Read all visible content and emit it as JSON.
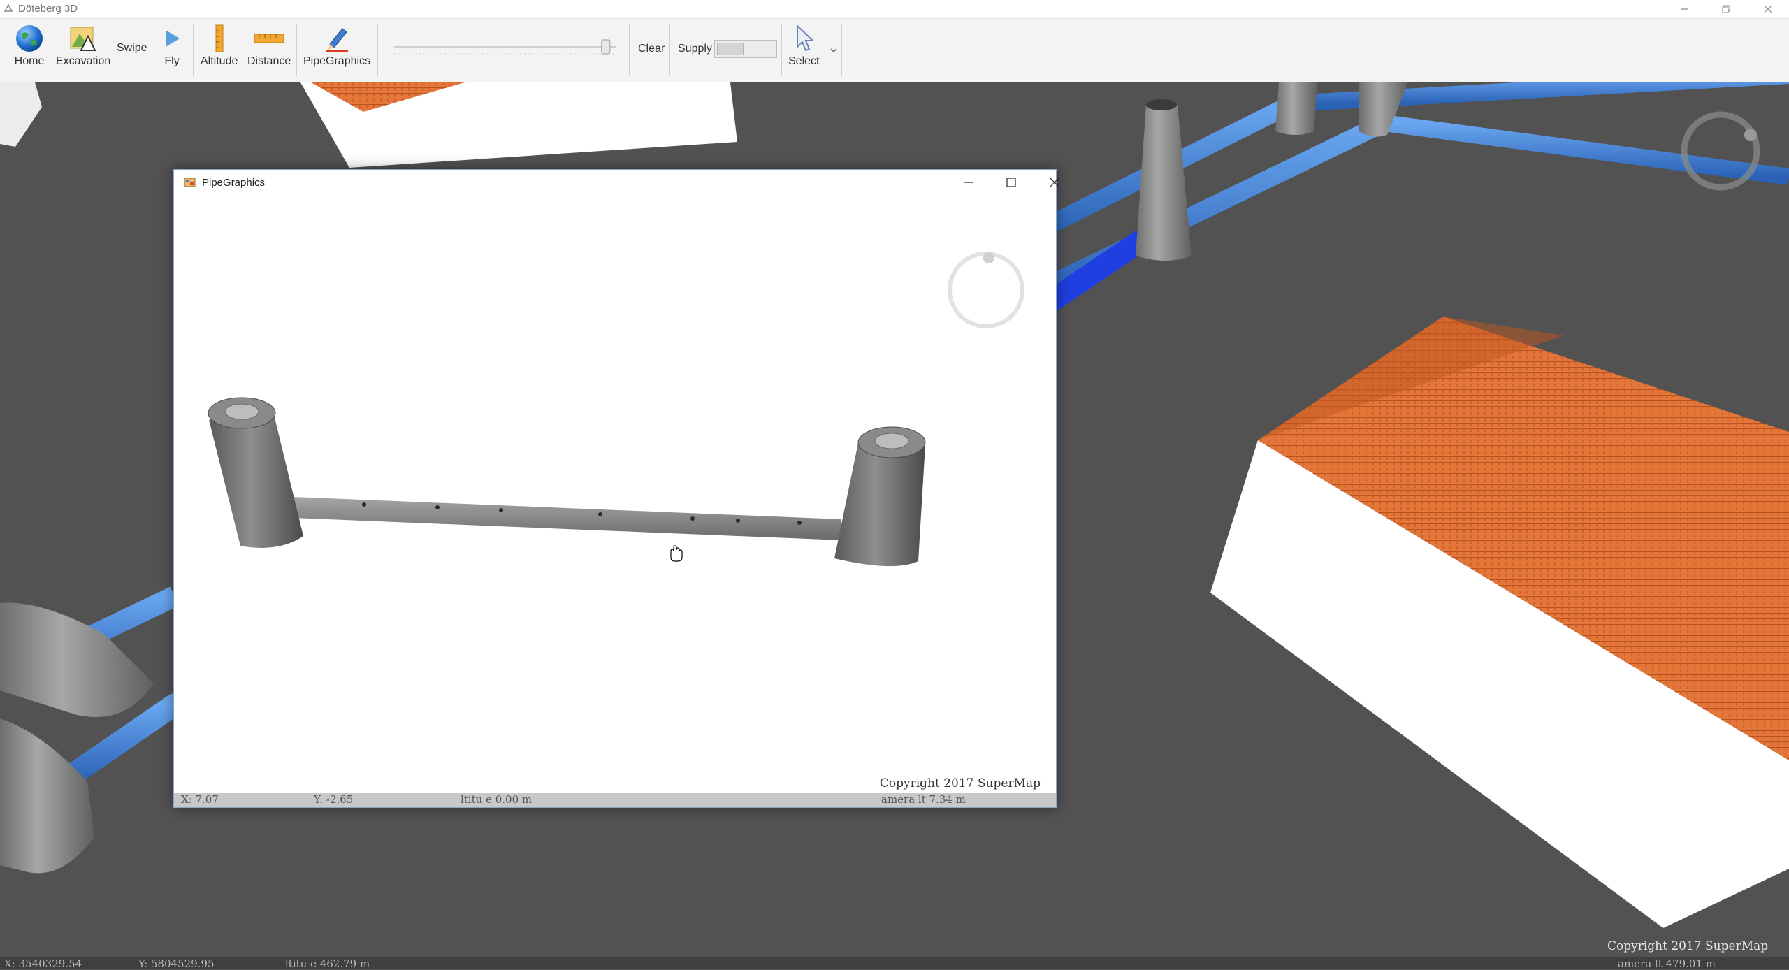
{
  "app": {
    "title": "Döteberg 3D"
  },
  "toolbar": {
    "home_label": "Home",
    "excavation_label": "Excavation",
    "swipe_label": "Swipe",
    "fly_label": "Fly",
    "altitude_label": "Altitude",
    "distance_label": "Distance",
    "pipegraphics_label": "PipeGraphics",
    "clear_label": "Clear",
    "supply_label": "Supply",
    "select_label": "Select",
    "slider_level": 0.97
  },
  "main_status": {
    "x": "X: 3540329.54",
    "y": "Y: 5804529.95",
    "altitude": "ltitu  e  462.79  m",
    "copyright": "Copyright 2017 SuperMap",
    "camera": "amera   lt  479.01  m"
  },
  "dialog": {
    "title": "PipeGraphics",
    "copyright": "Copyright 2017 SuperMap",
    "status": {
      "x": "X: 7.07",
      "y": "Y: -2.65",
      "altitude": "ltitu  e  0.00  m",
      "camera": "amera   lt  7.34  m"
    }
  },
  "colors": {
    "pipe_blue": "#3f7fd6",
    "roof_orange": "#e4763a",
    "ground": "#525252",
    "concrete": "#8c8c8c"
  }
}
